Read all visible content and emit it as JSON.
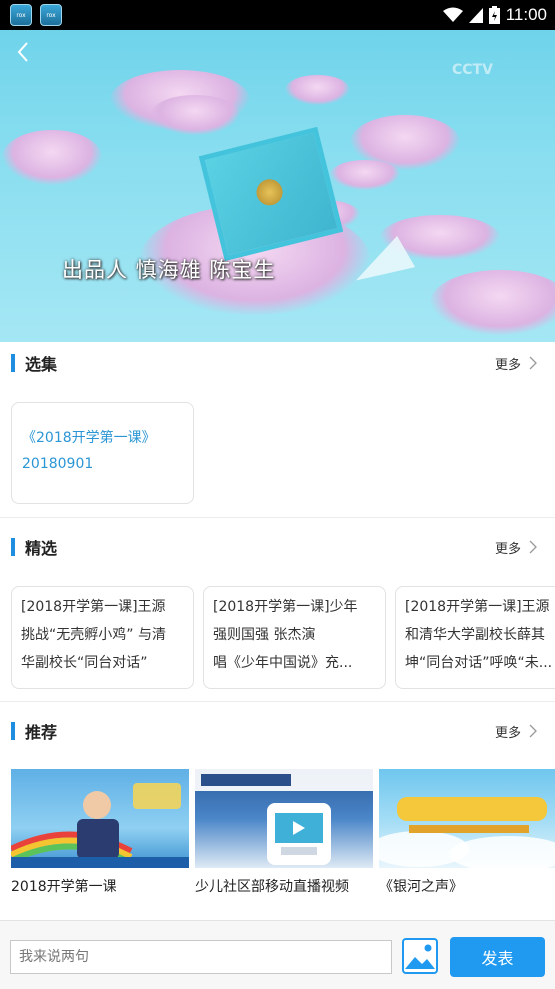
{
  "status_bar": {
    "time": "11:00",
    "app_icon_label": "rox",
    "colors": {
      "background": "#000000"
    }
  },
  "video": {
    "subtitle": "出品人  慎海雄   陈宝生",
    "watermark_right": "CCTV"
  },
  "sections": {
    "episodes": {
      "title": "选集",
      "more_label": "更多",
      "items": [
        {
          "title": "《2018开学第一课》",
          "date": "20180901"
        }
      ]
    },
    "featured": {
      "title": "精选",
      "more_label": "更多",
      "items": [
        {
          "lines": [
            "[2018开学第一课]王源",
            "挑战“无壳孵小鸡” 与清",
            "华副校长“同台对话”"
          ]
        },
        {
          "lines": [
            "[2018开学第一课]少年",
            "强则国强 张杰演",
            "唱《少年中国说》充..."
          ]
        },
        {
          "lines": [
            "[2018开学第一课]王源",
            "和清华大学副校长薛其",
            "坤“同台对话”呼唤“未..."
          ]
        }
      ]
    },
    "recommended": {
      "title": "推荐",
      "more_label": "更多",
      "items": [
        {
          "caption": "2018开学第一课"
        },
        {
          "caption": "少儿社区部移动直播视频"
        },
        {
          "caption": "《银河之声》"
        }
      ]
    }
  },
  "comment_bar": {
    "placeholder": "我来说两句",
    "submit_label": "发表"
  },
  "colors": {
    "accent": "#1f8ee0",
    "link": "#2a96d4",
    "submit_button": "#1f9af0"
  },
  "icons": [
    "wifi-icon",
    "signal-icon",
    "battery-icon",
    "back-icon",
    "chevron-right-icon",
    "image-picker-icon"
  ]
}
